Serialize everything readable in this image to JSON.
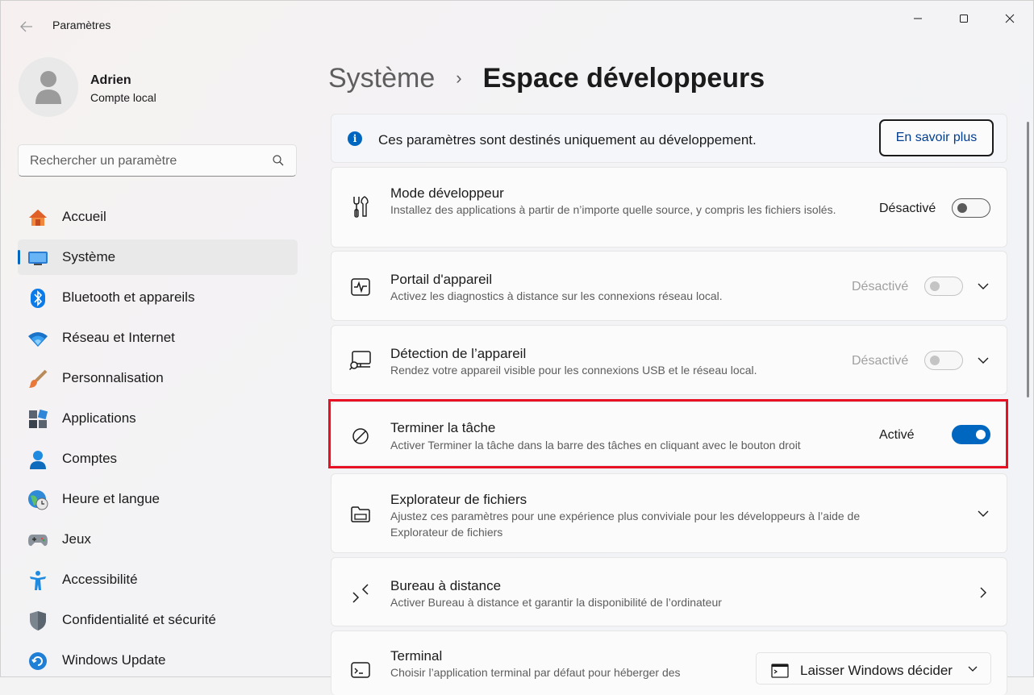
{
  "window": {
    "title": "Paramètres"
  },
  "profile": {
    "name": "Adrien",
    "account_type": "Compte local"
  },
  "search": {
    "placeholder": "Rechercher un paramètre"
  },
  "sidebar": {
    "items": [
      {
        "label": "Accueil",
        "icon": "home-icon"
      },
      {
        "label": "Système",
        "icon": "system-icon",
        "active": true
      },
      {
        "label": "Bluetooth et appareils",
        "icon": "bluetooth-icon"
      },
      {
        "label": "Réseau et Internet",
        "icon": "wifi-icon"
      },
      {
        "label": "Personnalisation",
        "icon": "brush-icon"
      },
      {
        "label": "Applications",
        "icon": "apps-icon"
      },
      {
        "label": "Comptes",
        "icon": "accounts-icon"
      },
      {
        "label": "Heure et langue",
        "icon": "globe-clock-icon"
      },
      {
        "label": "Jeux",
        "icon": "gamepad-icon"
      },
      {
        "label": "Accessibilité",
        "icon": "accessibility-icon"
      },
      {
        "label": "Confidentialité et sécurité",
        "icon": "shield-icon"
      },
      {
        "label": "Windows Update",
        "icon": "update-icon"
      }
    ]
  },
  "breadcrumb": {
    "parent": "Système",
    "separator": "›",
    "current": "Espace développeurs"
  },
  "info": {
    "text": "Ces paramètres sont destinés uniquement au développement.",
    "button": "En savoir plus"
  },
  "settings": [
    {
      "title": "Mode développeur",
      "desc": "Installez des applications à partir de n’importe quelle source, y compris les fichiers isolés.",
      "state": "Désactivé",
      "toggle_on": false,
      "enabled": true,
      "icon": "tools-icon"
    },
    {
      "title": "Portail d'appareil",
      "desc": "Activez les diagnostics à distance sur les connexions réseau local.",
      "state": "Désactivé",
      "toggle_on": false,
      "enabled": false,
      "icon": "pulse-monitor-icon"
    },
    {
      "title": "Détection de l’appareil",
      "desc": "Rendez votre appareil visible pour les connexions USB et le réseau local.",
      "state": "Désactivé",
      "toggle_on": false,
      "enabled": false,
      "icon": "device-search-icon"
    },
    {
      "title": "Terminer la tâche",
      "desc": "Activer Terminer la tâche dans la barre des tâches en cliquant avec le bouton droit",
      "state": "Activé",
      "toggle_on": true,
      "enabled": true,
      "icon": "block-icon"
    },
    {
      "title": "Explorateur de fichiers",
      "desc": "Ajustez ces paramètres pour une expérience plus conviviale pour les développeurs à l’aide de Explorateur de fichiers",
      "icon": "folder-icon"
    },
    {
      "title": "Bureau à distance",
      "desc": "Activer Bureau à distance et garantir la disponibilité de l’ordinateur",
      "icon": "remote-desktop-icon"
    },
    {
      "title": "Terminal",
      "desc": "Choisir l’application terminal par défaut pour héberger des",
      "icon": "terminal-icon",
      "dropdown_value": "Laisser Windows décider"
    }
  ],
  "colors": {
    "accent": "#0067c0",
    "highlight": "#e81123"
  }
}
